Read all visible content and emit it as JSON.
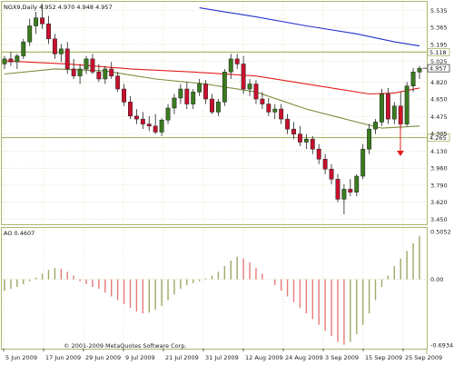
{
  "window": {
    "main_header": "NGX9,Daily  4.952 4.970 4.948 4.957",
    "ao_header": "AO 0.4607",
    "copyright": "© 2001-2009 MetaQuotes Software Corp."
  },
  "chart_data": [
    {
      "type": "candlestick",
      "title": "NGX9,Daily",
      "quote": {
        "open": 4.952,
        "high": 4.97,
        "low": 4.948,
        "close": 4.957
      },
      "ylim": [
        3.4,
        5.62
      ],
      "yticks": [
        5.535,
        5.365,
        5.195,
        5.025,
        4.82,
        4.65,
        4.475,
        4.305,
        4.13,
        3.96,
        3.79,
        3.62,
        3.45
      ],
      "xticks": [
        "5 Jun 2009",
        "17 Jun 2009",
        "29 Jun 2009",
        "9 Jul 2009",
        "21 Jul 2009",
        "31 Jul 2009",
        "12 Aug 2009",
        "24 Aug 2009",
        "3 Sep 2009",
        "15 Sep 2009",
        "25 Sep 2009"
      ],
      "horizontal_lines": [
        {
          "value": 5.118,
          "label": "5.118",
          "color": "#a8b86c"
        },
        {
          "value": 4.265,
          "label": "4.265",
          "color": "#a8b86c"
        }
      ],
      "price_label": {
        "value": 4.957,
        "label": "4.957"
      },
      "ohlc": [
        [
          5.0,
          5.08,
          4.95,
          5.05
        ],
        [
          5.05,
          5.12,
          4.98,
          5.02
        ],
        [
          5.02,
          5.1,
          4.95,
          5.08
        ],
        [
          5.08,
          5.25,
          5.05,
          5.22
        ],
        [
          5.22,
          5.45,
          5.18,
          5.38
        ],
        [
          5.38,
          5.52,
          5.3,
          5.46
        ],
        [
          5.46,
          5.6,
          5.35,
          5.4
        ],
        [
          5.4,
          5.48,
          5.2,
          5.25
        ],
        [
          5.25,
          5.3,
          5.05,
          5.1
        ],
        [
          5.1,
          5.2,
          5.02,
          5.15
        ],
        [
          5.15,
          5.22,
          4.9,
          4.95
        ],
        [
          4.95,
          5.05,
          4.85,
          4.88
        ],
        [
          4.88,
          5.0,
          4.8,
          4.95
        ],
        [
          4.95,
          5.08,
          4.9,
          5.05
        ],
        [
          5.05,
          5.1,
          4.9,
          4.92
        ],
        [
          4.92,
          5.0,
          4.82,
          4.85
        ],
        [
          4.85,
          4.98,
          4.8,
          4.95
        ],
        [
          4.95,
          5.02,
          4.85,
          4.88
        ],
        [
          4.88,
          4.92,
          4.72,
          4.75
        ],
        [
          4.75,
          4.8,
          4.58,
          4.62
        ],
        [
          4.62,
          4.68,
          4.45,
          4.48
        ],
        [
          4.48,
          4.55,
          4.4,
          4.45
        ],
        [
          4.45,
          4.52,
          4.35,
          4.4
        ],
        [
          4.4,
          4.48,
          4.33,
          4.38
        ],
        [
          4.38,
          4.5,
          4.3,
          4.32
        ],
        [
          4.32,
          4.46,
          4.28,
          4.44
        ],
        [
          4.44,
          4.6,
          4.4,
          4.56
        ],
        [
          4.56,
          4.7,
          4.5,
          4.66
        ],
        [
          4.66,
          4.8,
          4.6,
          4.75
        ],
        [
          4.75,
          4.82,
          4.55,
          4.6
        ],
        [
          4.6,
          4.75,
          4.55,
          4.72
        ],
        [
          4.72,
          4.85,
          4.68,
          4.8
        ],
        [
          4.8,
          4.84,
          4.6,
          4.65
        ],
        [
          4.65,
          4.7,
          4.5,
          4.52
        ],
        [
          4.52,
          4.65,
          4.48,
          4.62
        ],
        [
          4.62,
          4.95,
          4.58,
          4.92
        ],
        [
          4.92,
          5.1,
          4.85,
          5.05
        ],
        [
          5.05,
          5.1,
          4.95,
          5.0
        ],
        [
          5.0,
          5.08,
          4.7,
          4.75
        ],
        [
          4.75,
          4.85,
          4.68,
          4.8
        ],
        [
          4.8,
          4.84,
          4.6,
          4.65
        ],
        [
          4.65,
          4.72,
          4.55,
          4.6
        ],
        [
          4.6,
          4.66,
          4.48,
          4.52
        ],
        [
          4.52,
          4.6,
          4.45,
          4.55
        ],
        [
          4.55,
          4.6,
          4.4,
          4.45
        ],
        [
          4.45,
          4.5,
          4.3,
          4.35
        ],
        [
          4.35,
          4.42,
          4.25,
          4.3
        ],
        [
          4.3,
          4.38,
          4.18,
          4.22
        ],
        [
          4.22,
          4.3,
          4.15,
          4.25
        ],
        [
          4.25,
          4.28,
          4.1,
          4.15
        ],
        [
          4.15,
          4.2,
          4.0,
          4.05
        ],
        [
          4.05,
          4.1,
          3.9,
          3.95
        ],
        [
          3.95,
          4.0,
          3.8,
          3.85
        ],
        [
          3.85,
          3.9,
          3.62,
          3.65
        ],
        [
          3.65,
          3.8,
          3.5,
          3.75
        ],
        [
          3.75,
          3.85,
          3.68,
          3.72
        ],
        [
          3.72,
          3.9,
          3.68,
          3.88
        ],
        [
          3.88,
          4.2,
          3.85,
          4.15
        ],
        [
          4.15,
          4.4,
          4.1,
          4.35
        ],
        [
          4.35,
          4.45,
          4.3,
          4.42
        ],
        [
          4.42,
          4.75,
          4.38,
          4.7
        ],
        [
          4.7,
          4.76,
          4.4,
          4.45
        ],
        [
          4.45,
          4.62,
          4.4,
          4.58
        ],
        [
          4.58,
          4.72,
          4.35,
          4.4
        ],
        [
          4.4,
          4.82,
          4.38,
          4.78
        ],
        [
          4.78,
          4.96,
          4.72,
          4.92
        ],
        [
          4.92,
          4.98,
          4.85,
          4.957
        ]
      ],
      "moving_averages": [
        {
          "color": "#2233cc",
          "values_by_bar": [
            [
              31,
              5.56
            ],
            [
              40,
              5.47
            ],
            [
              48,
              5.38
            ],
            [
              56,
              5.3
            ],
            [
              62,
              5.22
            ],
            [
              66,
              5.18
            ]
          ]
        },
        {
          "color": "#e0201e",
          "values_by_bar": [
            [
              0,
              5.03
            ],
            [
              10,
              5.0
            ],
            [
              20,
              4.95
            ],
            [
              30,
              4.92
            ],
            [
              40,
              4.88
            ],
            [
              50,
              4.78
            ],
            [
              58,
              4.7
            ],
            [
              62,
              4.71
            ],
            [
              66,
              4.76
            ]
          ]
        },
        {
          "color": "#7a8a3a",
          "values_by_bar": [
            [
              0,
              4.9
            ],
            [
              8,
              4.95
            ],
            [
              16,
              4.93
            ],
            [
              24,
              4.85
            ],
            [
              32,
              4.8
            ],
            [
              40,
              4.72
            ],
            [
              48,
              4.55
            ],
            [
              56,
              4.42
            ],
            [
              60,
              4.36
            ],
            [
              66,
              4.38
            ]
          ]
        }
      ]
    },
    {
      "type": "bar",
      "title": "AO 0.4607",
      "ylim": [
        -0.6934,
        0.5052
      ],
      "yticks": [
        0.5052,
        0.0,
        -0.6934
      ],
      "values": [
        -0.12,
        -0.1,
        -0.08,
        -0.05,
        -0.02,
        0.02,
        0.06,
        0.1,
        0.12,
        0.11,
        0.08,
        0.04,
        -0.02,
        -0.05,
        -0.08,
        -0.1,
        -0.14,
        -0.18,
        -0.22,
        -0.26,
        -0.3,
        -0.34,
        -0.36,
        -0.35,
        -0.32,
        -0.28,
        -0.22,
        -0.16,
        -0.1,
        -0.06,
        -0.04,
        -0.02,
        0.01,
        0.04,
        0.08,
        0.14,
        0.2,
        0.24,
        0.22,
        0.18,
        0.12,
        0.06,
        0.0,
        -0.06,
        -0.12,
        -0.18,
        -0.24,
        -0.3,
        -0.36,
        -0.42,
        -0.48,
        -0.54,
        -0.6,
        -0.66,
        -0.69,
        -0.66,
        -0.58,
        -0.48,
        -0.36,
        -0.22,
        -0.08,
        0.04,
        0.14,
        0.22,
        0.3,
        0.38,
        0.46
      ]
    }
  ]
}
